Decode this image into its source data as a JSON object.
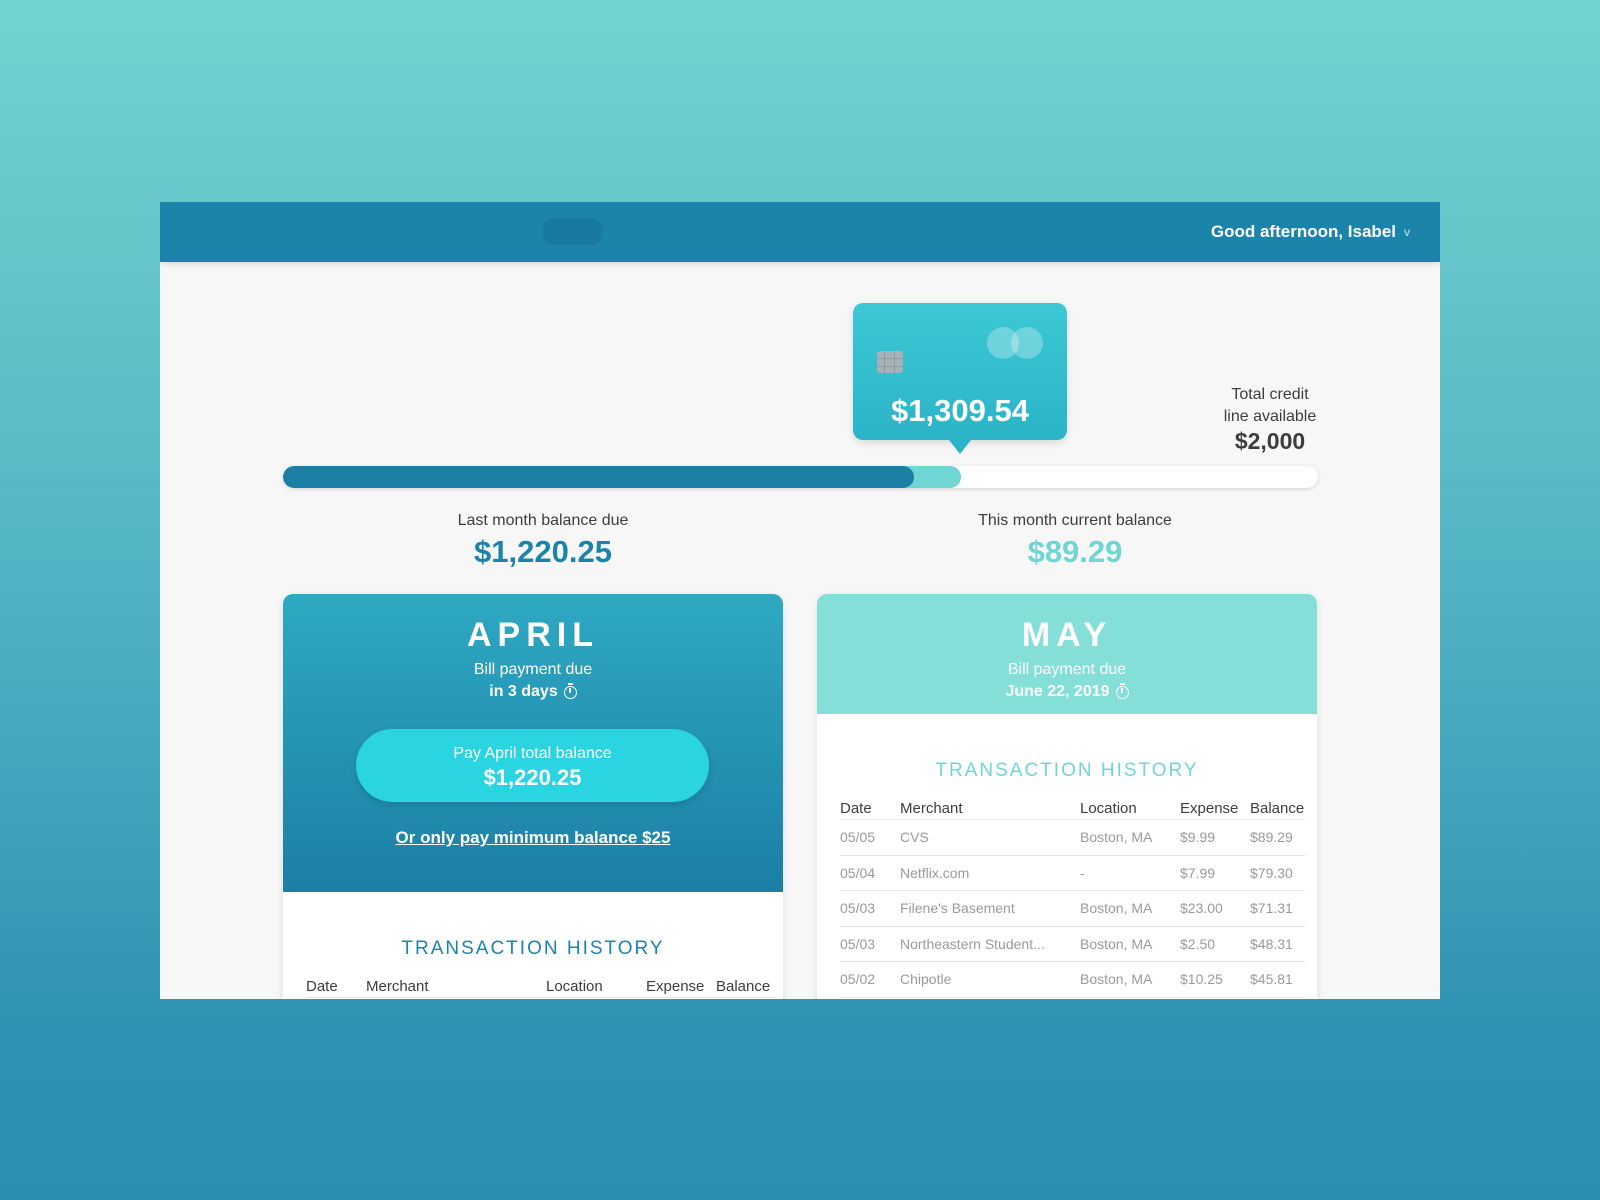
{
  "header": {
    "greeting": "Good afternoon, Isabel",
    "chevron": "v"
  },
  "card": {
    "amount": "$1,309.54",
    "chip_icon": "chip-icon",
    "network_icon": "mastercard-logo-icon"
  },
  "credit": {
    "label_line1": "Total credit",
    "label_line2": "line available",
    "amount": "$2,000"
  },
  "progress": {
    "last_month_fraction": 0.61,
    "total_used_fraction": 0.655
  },
  "balances": {
    "last_label": "Last month balance due",
    "last_value": "$1,220.25",
    "current_label": "This month current balance",
    "current_value": "$89.29"
  },
  "april": {
    "month": "APRIL",
    "due_label": "Bill payment due",
    "due_when": "in 3 days",
    "pay_label": "Pay April total balance",
    "pay_amount": "$1,220.25",
    "min_link": "Or only pay minimum balance $25",
    "history_title": "TRANSACTION HISTORY",
    "columns": [
      "Date",
      "Merchant",
      "Location",
      "Expense",
      "Balance"
    ]
  },
  "may": {
    "month": "MAY",
    "due_label": "Bill payment due",
    "due_when": "June 22, 2019",
    "history_title": "TRANSACTION HISTORY",
    "columns": [
      "Date",
      "Merchant",
      "Location",
      "Expense",
      "Balance"
    ],
    "rows": [
      [
        "05/05",
        "CVS",
        "Boston, MA",
        "$9.99",
        "$89.29"
      ],
      [
        "05/04",
        "Netflix.com",
        "-",
        "$7.99",
        "$79.30"
      ],
      [
        "05/03",
        "Filene's Basement",
        "Boston, MA",
        "$23.00",
        "$71.31"
      ],
      [
        "05/03",
        "Northeastern Student...",
        "Boston, MA",
        "$2.50",
        "$48.31"
      ],
      [
        "05/02",
        "Chipotle",
        "Boston, MA",
        "$10.25",
        "$45.81"
      ]
    ]
  },
  "colors": {
    "primary": "#1c84ab",
    "accent": "#6fd6d3",
    "button": "#2ad4e0"
  }
}
